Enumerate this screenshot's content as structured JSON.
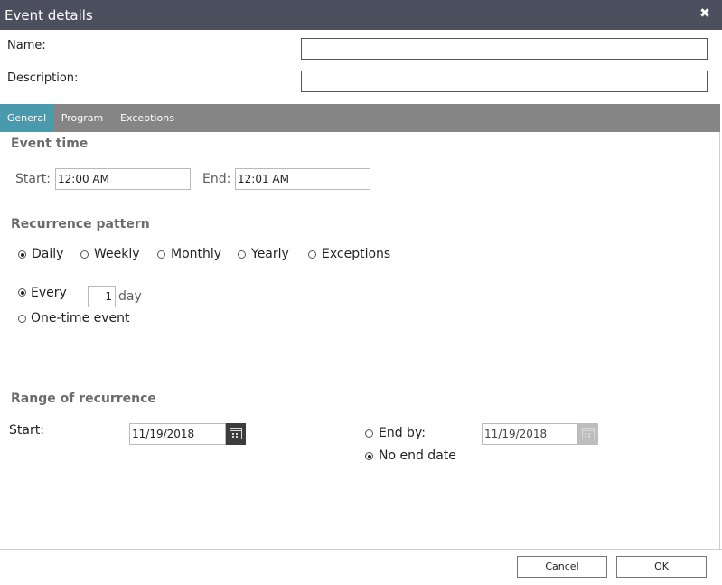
{
  "dialog": {
    "title": "Event details",
    "close_icon": "close-icon"
  },
  "fields": {
    "name_label": "Name:",
    "name_value": "",
    "description_label": "Description:",
    "description_value": ""
  },
  "tabs": [
    {
      "label": "General",
      "active": true
    },
    {
      "label": "Program",
      "active": false
    },
    {
      "label": "Exceptions",
      "active": false
    }
  ],
  "event_time": {
    "heading": "Event time",
    "start_label": "Start:",
    "start_value": "12:00 AM",
    "end_label": "End:",
    "end_value": "12:01 AM"
  },
  "recurrence": {
    "heading": "Recurrence pattern",
    "options": [
      {
        "label": "Daily",
        "selected": true
      },
      {
        "label": "Weekly",
        "selected": false
      },
      {
        "label": "Monthly",
        "selected": false
      },
      {
        "label": "Yearly",
        "selected": false
      },
      {
        "label": "Exceptions",
        "selected": false
      }
    ],
    "every_label": "Every",
    "every_value": "1",
    "every_unit": "day",
    "every_selected": true,
    "one_time_label": "One-time event",
    "one_time_selected": false
  },
  "range": {
    "heading": "Range of recurrence",
    "start_label": "Start:",
    "start_value": "11/19/2018",
    "end_by_label": "End by:",
    "end_by_value": "11/19/2018",
    "end_by_selected": false,
    "no_end_label": "No end date",
    "no_end_selected": true
  },
  "footer": {
    "cancel_label": "Cancel",
    "ok_label": "OK"
  },
  "colors": {
    "titlebar": "#4b4f5e",
    "tabbar": "#858585",
    "tab_active": "#4a9aae",
    "date_button": "#3c3c3c",
    "date_button_disabled": "#bdbdbd"
  }
}
